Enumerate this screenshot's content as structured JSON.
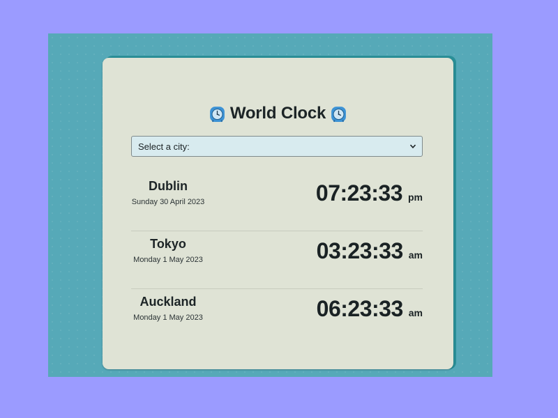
{
  "app": {
    "title": "World Clock",
    "title_icon": "alarm-clock-icon"
  },
  "colors": {
    "page_background": "#9b9bff",
    "backdrop": "#56a9b8",
    "card": "#dfe3d5",
    "select_background": "#d8ebef",
    "text": "#1c2426"
  },
  "city_select": {
    "selected_label": "Select a city:"
  },
  "clocks": [
    {
      "city": "Dublin",
      "date": "Sunday 30 April 2023",
      "time": "07:23:33",
      "period": "pm"
    },
    {
      "city": "Tokyo",
      "date": "Monday 1 May 2023",
      "time": "03:23:33",
      "period": "am"
    },
    {
      "city": "Auckland",
      "date": "Monday 1 May 2023",
      "time": "06:23:33",
      "period": "am"
    }
  ]
}
